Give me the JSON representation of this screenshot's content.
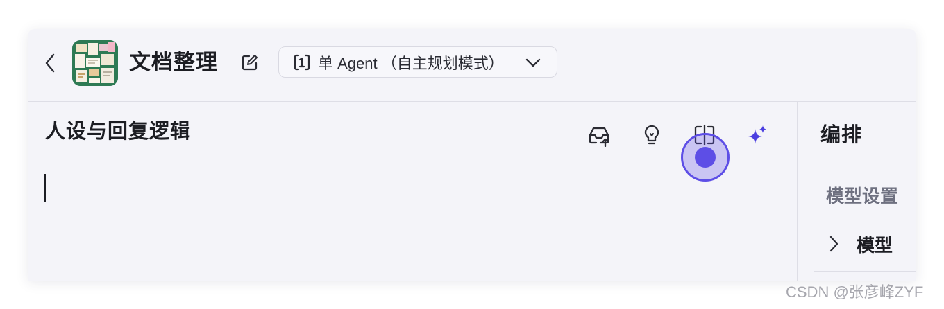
{
  "header": {
    "app_title": "文档整理",
    "mode_select": {
      "icon": "agent-mode-icon",
      "value": "单 Agent （自主规划模式）"
    }
  },
  "editor": {
    "section_title": "人设与回复逻辑",
    "toolbar": [
      {
        "icon": "inbox-upload-icon"
      },
      {
        "icon": "lightbulb-icon"
      },
      {
        "icon": "split-view-icon"
      },
      {
        "icon": "ai-sparkle-icon",
        "color": "#4b3fe0"
      }
    ],
    "content": ""
  },
  "sidebar": {
    "title": "编排",
    "section_label": "模型设置",
    "items": [
      {
        "label": "模型"
      }
    ]
  },
  "watermark": "CSDN @张彦峰ZYF",
  "colors": {
    "accent": "#5d4ee6",
    "panel_bg": "#f4f4f9",
    "text": "#1c1d23"
  }
}
